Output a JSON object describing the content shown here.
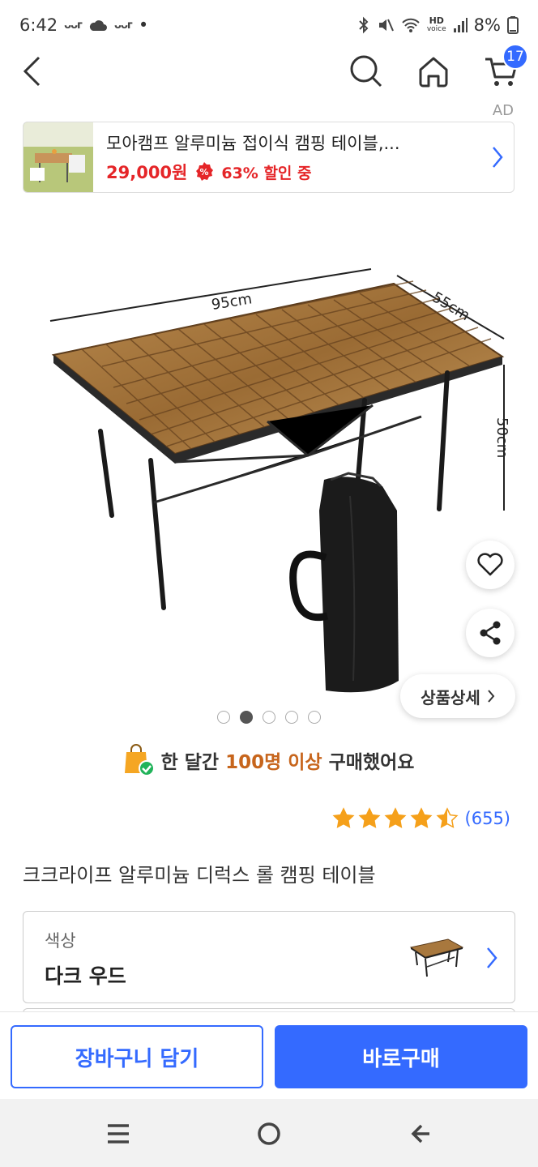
{
  "status_bar": {
    "time": "6:42",
    "icon_text_1": "ᴗᴗᴦ",
    "icon_text_2": "ᴗᴗᴦ",
    "dot": "•",
    "hd_top": "HD",
    "hd_bottom": "voice",
    "battery": "8%"
  },
  "nav": {
    "cart_count": "17"
  },
  "ad": {
    "label": "AD",
    "title": "모아캠프 알루미늄 접이식 캠핑 테이블,...",
    "price": "29,000원",
    "discount_badge": "%",
    "discount": "63% 할인 중"
  },
  "image": {
    "dim_width": "95cm",
    "dim_depth": "55cm",
    "dim_height": "50cm",
    "carousel_total": 5,
    "carousel_active": 2,
    "detail_button": "상품상세"
  },
  "purchase_note": {
    "prefix": "한 달간",
    "highlight": "100명 이상",
    "suffix": "구매했어요"
  },
  "rating": {
    "stars": 4.5,
    "review_count": "(655)"
  },
  "product": {
    "title": "크크라이프 알루미늄 디럭스 롤 캠핑 테이블"
  },
  "option": {
    "label": "색상",
    "value": "다크 우드"
  },
  "buttons": {
    "cart": "장바구니 담기",
    "buy": "바로구매"
  },
  "colors": {
    "accent": "#346aff",
    "price_red": "#e52528",
    "highlight_orange": "#c7651c",
    "star": "#f5a01a"
  }
}
